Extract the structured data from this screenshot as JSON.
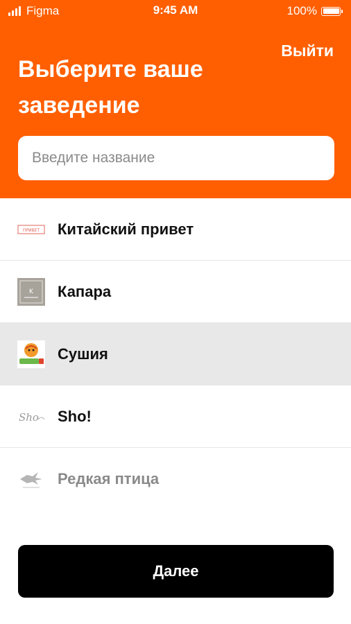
{
  "status_bar": {
    "carrier": "Figma",
    "time": "9:45 AM",
    "battery": "100%",
    "battery_level": 1.0
  },
  "header": {
    "logout_label": "Выйти",
    "title": "Выберите ваше заведение",
    "background": "#ff5f00"
  },
  "search": {
    "placeholder": "Введите название",
    "value": ""
  },
  "venues": [
    {
      "name": "Китайский привет",
      "logo": "kitayskiy-privet-logo",
      "logo_text": "привет",
      "selected": false
    },
    {
      "name": "Капара",
      "logo": "kapara-logo",
      "logo_text": "K",
      "selected": false
    },
    {
      "name": "Сушия",
      "logo": "sushiya-logo",
      "selected": true
    },
    {
      "name": "Sho!",
      "logo": "sho-logo",
      "logo_text": "Sho",
      "selected": false
    },
    {
      "name": "Редкая птица",
      "logo": "redkaya-ptitsa-logo",
      "selected": false
    }
  ],
  "footer": {
    "next_label": "Далее"
  }
}
